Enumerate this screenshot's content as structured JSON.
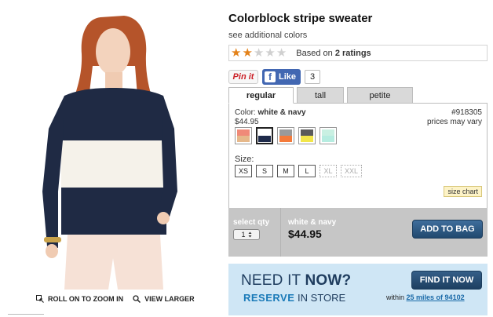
{
  "product": {
    "title": "Colorblock stripe sweater",
    "see_colors": "see additional colors"
  },
  "rating": {
    "stars_filled": 2,
    "stars_total": 5,
    "prefix": "Based on",
    "count_text": "2 ratings"
  },
  "social": {
    "pinit_label": "Pin it",
    "like_label": "Like",
    "like_count": "3"
  },
  "tabs": [
    {
      "label": "regular",
      "active": true
    },
    {
      "label": "tall",
      "active": false
    },
    {
      "label": "petite",
      "active": false
    }
  ],
  "color": {
    "label": "Color:",
    "value": "white & navy",
    "price": "$44.95",
    "sku": "#918305",
    "price_note": "prices may vary",
    "swatches": [
      {
        "name": "coral & tan",
        "top": "#f08a78",
        "bottom": "#e6b88a",
        "selected": false
      },
      {
        "name": "white & navy",
        "top": "#ffffff",
        "bottom": "#1e2a4a",
        "selected": true
      },
      {
        "name": "grey & orange",
        "top": "#9a9a9a",
        "bottom": "#f47a3a",
        "selected": false
      },
      {
        "name": "charcoal & yellow",
        "top": "#5a5a5a",
        "bottom": "#f2e64a",
        "selected": false
      },
      {
        "name": "mint",
        "top": "#c9f0e2",
        "bottom": "#b6ece0",
        "selected": false
      }
    ]
  },
  "size": {
    "label": "Size:",
    "options": [
      {
        "label": "XS",
        "available": true
      },
      {
        "label": "S",
        "available": true
      },
      {
        "label": "M",
        "available": true
      },
      {
        "label": "L",
        "available": true
      },
      {
        "label": "XL",
        "available": false
      },
      {
        "label": "XXL",
        "available": false
      }
    ],
    "chart_link": "size chart"
  },
  "bag": {
    "qty_label": "select qty",
    "qty_value": "1",
    "color_name": "white & navy",
    "price": "$44.95",
    "button": "ADD TO BAG"
  },
  "store": {
    "need_prefix": "NEED IT",
    "need_bold": "NOW?",
    "reserve_bold": "RESERVE",
    "reserve_rest": "IN STORE",
    "button": "FIND IT NOW",
    "within_text": "within",
    "within_link": "25 miles of 94102"
  },
  "image_tools": {
    "zoom_label": "ROLL ON TO ZOOM IN",
    "view_label": "VIEW LARGER"
  },
  "colors": {
    "navy": "#1f2a44",
    "cream": "#f5f2ea",
    "star": "#e3821a",
    "button_blue": "#2a5680",
    "banner_bg": "#cfe6f5"
  }
}
